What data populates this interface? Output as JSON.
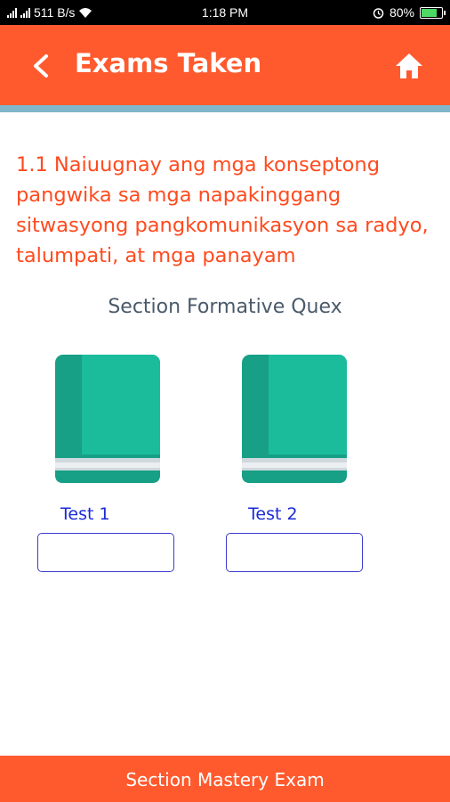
{
  "status_bar": {
    "network_speed": "511 B/s",
    "time": "1:18 PM",
    "battery": "80%",
    "battery_level": 0.8
  },
  "app_bar": {
    "title": "Exams Taken",
    "back_icon": "chevron-left-icon",
    "home_icon": "home-icon"
  },
  "objective": "1.1 Naiuugnay ang mga konseptong pangwika sa mga napakinggang sitwasyong pangkomunikasyon sa radyo, talumpati, at mga panayam",
  "section_label": "Section Formative Quex",
  "tests": [
    {
      "label": "Test 1",
      "score": ""
    },
    {
      "label": "Test 2",
      "score": ""
    }
  ],
  "bottom_button": "Section Mastery Exam",
  "colors": {
    "primary": "#ff5a2e",
    "book": "#1abc9c",
    "link": "#1a2bd6"
  }
}
